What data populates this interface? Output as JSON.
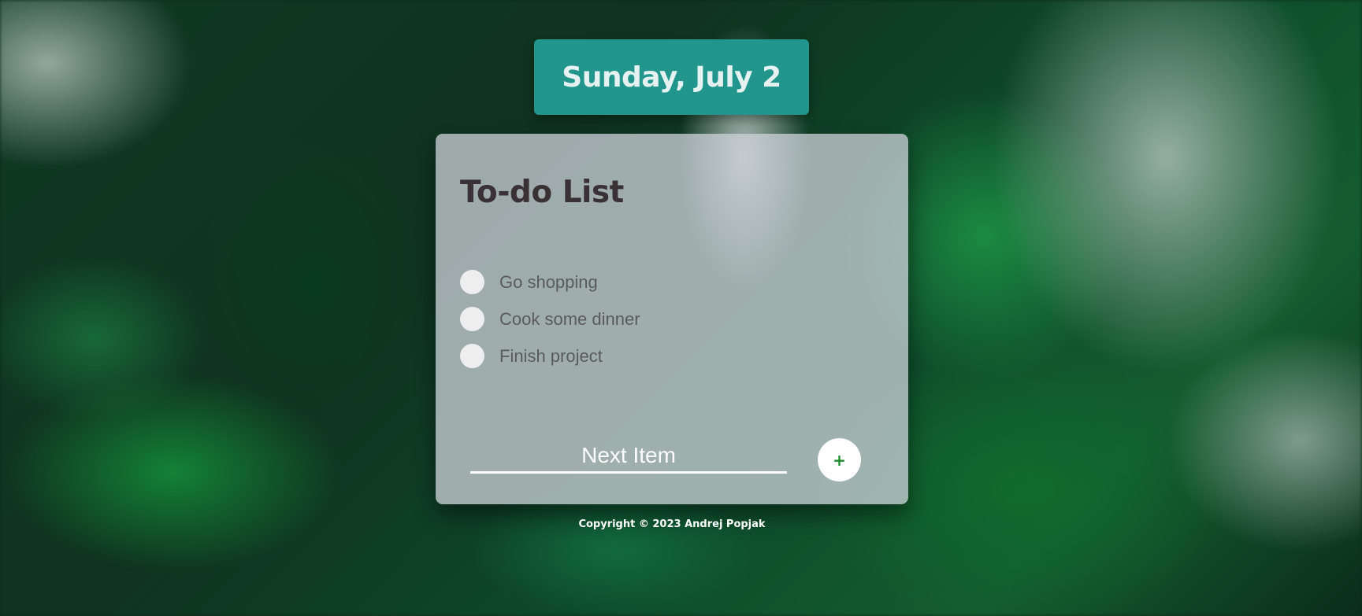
{
  "header": {
    "date": "Sunday, July 2"
  },
  "todo": {
    "title": "To-do List",
    "items": [
      {
        "label": "Go shopping",
        "checked": false
      },
      {
        "label": "Cook some dinner",
        "checked": false
      },
      {
        "label": "Finish project",
        "checked": false
      }
    ],
    "input_placeholder": "Next Item",
    "input_value": "",
    "add_label": "+"
  },
  "footer": {
    "copyright": "Copyright © 2023 Andrej Popjak"
  },
  "colors": {
    "banner": "#22968c",
    "title": "#3a3134",
    "add_icon": "#1a8a2a"
  }
}
